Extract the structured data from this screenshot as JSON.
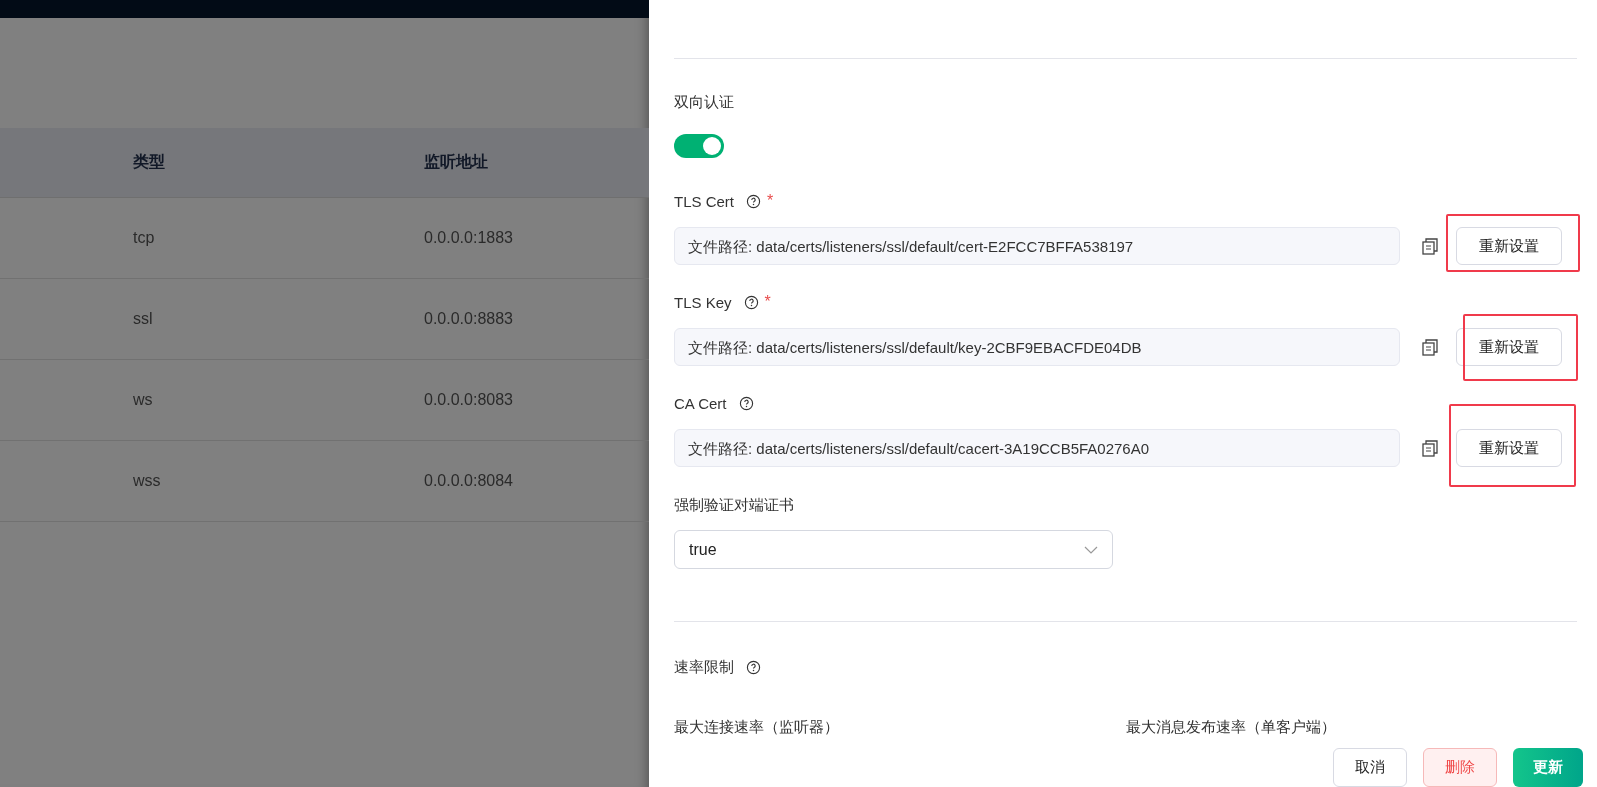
{
  "table": {
    "columns": [
      "类型",
      "监听地址"
    ],
    "rows": [
      {
        "type": "tcp",
        "address": "0.0.0.0:1883"
      },
      {
        "type": "ssl",
        "address": "0.0.0.0:8883"
      },
      {
        "type": "ws",
        "address": "0.0.0.0:8083"
      },
      {
        "type": "wss",
        "address": "0.0.0.0:8084"
      }
    ]
  },
  "drawer": {
    "mutual_auth": {
      "label": "双向认证",
      "on": true
    },
    "cert_fields": [
      {
        "label": "TLS Cert",
        "required_mark": "*",
        "value": "文件路径: data/certs/listeners/ssl/default/cert-E2FCC7BFFA538197",
        "button": "重新设置",
        "highlighted": true
      },
      {
        "label": "TLS Key",
        "required_mark": "*",
        "value": "文件路径: data/certs/listeners/ssl/default/key-2CBF9EBACFDE04DB",
        "button": "重新设置",
        "highlighted": true
      },
      {
        "label": "CA Cert",
        "value": "文件路径: data/certs/listeners/ssl/default/cacert-3A19CCB5FA0276A0",
        "button": "重新设置",
        "highlighted": true
      }
    ],
    "verify_peer": {
      "label": "强制验证对端证书",
      "value": "true"
    },
    "rate_limit": {
      "title": "速率限制",
      "fields": [
        "最大连接速率（监听器）",
        "最大消息发布速率（单客户端）"
      ]
    },
    "footer": {
      "cancel": "取消",
      "delete": "删除",
      "update": "更新"
    }
  }
}
